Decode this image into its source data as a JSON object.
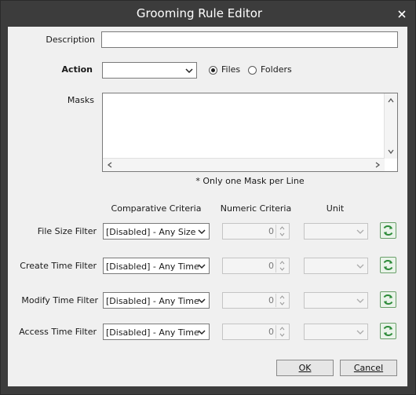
{
  "window": {
    "title": "Grooming Rule Editor"
  },
  "form": {
    "description_label": "Description",
    "description_value": "",
    "action_label": "Action",
    "action_value": "",
    "radio_files": "Files",
    "radio_folders": "Folders",
    "selected_target": "Files",
    "masks_label": "Masks",
    "masks_value": "",
    "masks_note": "* Only one Mask per Line"
  },
  "filters": {
    "headers": {
      "comparative": "Comparative Criteria",
      "numeric": "Numeric Criteria",
      "unit": "Unit"
    },
    "rows": [
      {
        "label": "File Size Filter",
        "comparative": "[Disabled] - Any Size",
        "numeric": "0",
        "unit": ""
      },
      {
        "label": "Create Time Filter",
        "comparative": "[Disabled] - Any Time",
        "numeric": "0",
        "unit": ""
      },
      {
        "label": "Modify Time Filter",
        "comparative": "[Disabled] - Any Time",
        "numeric": "0",
        "unit": ""
      },
      {
        "label": "Access Time Filter",
        "comparative": "[Disabled] - Any Time",
        "numeric": "0",
        "unit": ""
      }
    ]
  },
  "buttons": {
    "ok": "OK",
    "cancel": "Cancel"
  },
  "icons": {
    "close": "close-icon",
    "refresh": "refresh-icon",
    "dropdown": "chevron-down-icon"
  },
  "colors": {
    "titlebar": "#3c3c3c",
    "client": "#f0f0f0",
    "refresh_accent": "#2e8b3a"
  }
}
